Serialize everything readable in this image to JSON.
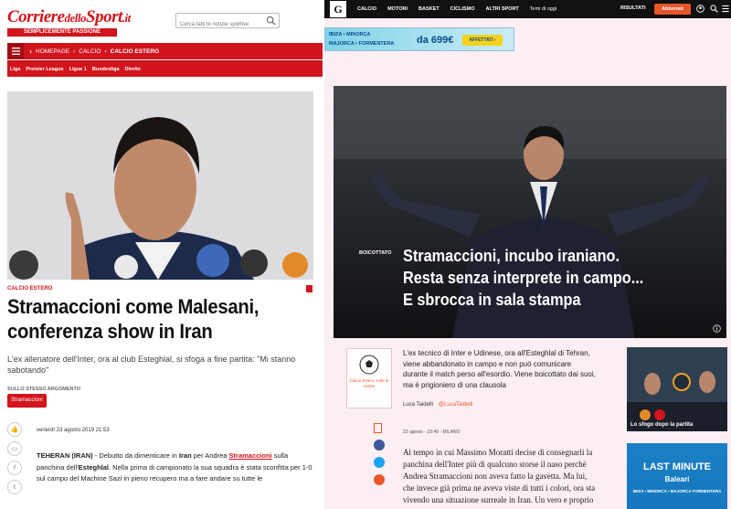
{
  "left": {
    "logo": "Corriere",
    "logo_small": "dello",
    "logo_tail": "Sport",
    "logo_domain": ".it",
    "logo_sub": "SEMPLICEMENTE PASSIONE",
    "search_placeholder": "Cerca fatti le notizie sportive",
    "breadcrumb_home": "HOMEPAGE",
    "breadcrumb_calcio": "CALCIO",
    "breadcrumb_estero": "CALCIO ESTERO",
    "subnav": [
      "Liga",
      "Premier League",
      "Ligue 1",
      "Bundesliga",
      "Dirette"
    ],
    "category": "CALCIO ESTERO",
    "title": "Stramaccioni come Malesani, conferenza show in Iran",
    "lead": "L'ex allenatore dell'Inter, ora al club Esteghlal, si sfoga a fine partita: \"Mi stanno sabotando\"",
    "same_topic": "SULLO STESSO ARGOMENTO",
    "tag": "Stramaccioni",
    "date": "venerdì 23 agosto 2019 21:53",
    "body": {
      "p1": "TEHERAN (IRAN)",
      "p2": " - Debutto da dimenticare in ",
      "p3": "Iran",
      "p4": " per Andrea ",
      "p5": "Stramaccioni",
      "p6": " sulla panchina dell'",
      "p7": "Esteghlal",
      "p8": ". Nella prima di campionato la sua squadra è stata sconfitta per 1-0 sul campo del Machine Sazi in pieno recupero ma a fare andare su tutte le"
    }
  },
  "right": {
    "logo": "G",
    "nav": [
      "CALCIO",
      "MOTORI",
      "BASKET",
      "CICLISMO",
      "ALTRI SPORT",
      "Temi di oggi"
    ],
    "results": "RISULTATI",
    "subscribe": "Abbonati",
    "ad": {
      "line1": "IBIZA • MINORCA",
      "line2": "MAJORCA • FORMENTERA",
      "price": "da 699€",
      "button": "AFFETTATI ›"
    },
    "hero_category": "BOICOTTATO",
    "hero_title": "Stramaccioni, incubo iraniano. Resta senza interprete in campo... E sbrocca in sala stampa",
    "box_label": "Calcio Estero: tutte le notizie",
    "lead": "L'ex tecnico di Inter e Udinese, ora all'Esteghlal di Tehran, viene abbandonato in campo e non può comunicare durante il match perso all'esordio. Viene boicottato dai suoi, ma è prigioniero di una clausola",
    "author": "Luca Taidelli",
    "author_twitter": "@LucaTaidelli",
    "date": "23 agosto - 23:49 - MILANO",
    "body": "Al tempo in cui Massimo Moratti decise di consegnarli la panchina dell'Inter più di qualcuno storse il naso perché Andrea Stramaccioni non aveva fatto la gavetta. Ma lui, che invece già prima ne aveva viste di tutti i colori, ora sta vivendo una situazione surreale in Iran. Un vero e proprio",
    "video_caption": "Lo sfogo dopo la partita",
    "lastminute": {
      "title": "LAST MINUTE",
      "dest": "Baleari",
      "islands": "IBIZA • MINORCA • MAJORCA FORMENTERA"
    }
  },
  "colors": {
    "cds_red": "#d2141c",
    "gazzetta_pink": "#fbeff3",
    "accent_orange": "#e8562a"
  }
}
